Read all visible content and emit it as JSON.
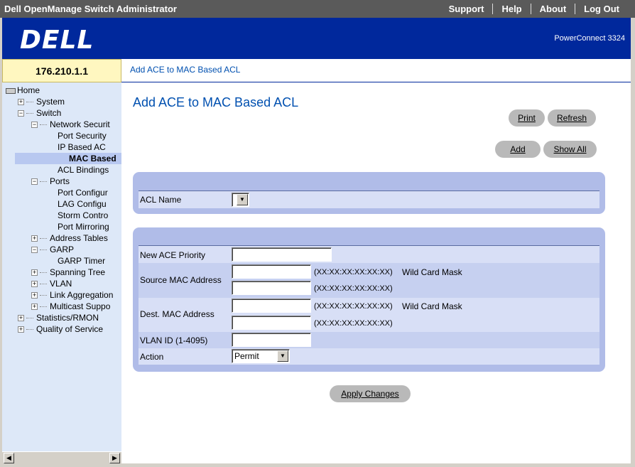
{
  "top_bar": {
    "title": "Dell OpenManage Switch Administrator",
    "links": [
      "Support",
      "Help",
      "About",
      "Log Out"
    ]
  },
  "banner": {
    "logo": "D€LL",
    "model": "PowerConnect 3324"
  },
  "device_ip": "176.210.1.1",
  "breadcrumb": "Add ACE to MAC Based ACL",
  "tree": {
    "home": "Home",
    "system": "System",
    "switch": "Switch",
    "network_security": "Network Securit",
    "port_security": "Port Security",
    "ip_based_acl": "IP Based AC",
    "mac_based_acl": "MAC Based",
    "acl_bindings": "ACL Bindings",
    "ports": "Ports",
    "port_config": "Port Configur",
    "lag_config": "LAG Configu",
    "storm_control": "Storm Contro",
    "port_mirroring": "Port Mirroring",
    "address_tables": "Address Tables",
    "garp": "GARP",
    "garp_timers": "GARP Timer",
    "spanning_tree": "Spanning Tree",
    "vlan": "VLAN",
    "link_aggregation": "Link Aggregation",
    "multicast_support": "Multicast Suppo",
    "statistics_rmon": "Statistics/RMON",
    "quality_of_service": "Quality of Service"
  },
  "page": {
    "title": "Add ACE to MAC Based ACL",
    "buttons": {
      "print": "Print",
      "refresh": "Refresh",
      "add": "Add",
      "show_all": "Show All",
      "apply": "Apply Changes"
    }
  },
  "form": {
    "acl_name_label": "ACL Name",
    "acl_name_value": "",
    "new_ace_priority_label": "New ACE Priority",
    "new_ace_priority_value": "",
    "source_mac_label": "Source MAC Address",
    "source_mac_value": "",
    "source_mac_mask_value": "",
    "dest_mac_label": "Dest. MAC Address",
    "dest_mac_value": "",
    "dest_mac_mask_value": "",
    "mac_format_hint": "(XX:XX:XX:XX:XX:XX)",
    "wild_card_mask_label": "Wild Card Mask",
    "vlan_id_label": "VLAN ID (1-4095)",
    "vlan_id_value": "",
    "action_label": "Action",
    "action_value": "Permit"
  },
  "colors": {
    "banner_blue": "#00289c",
    "title_blue": "#0050b0",
    "panel": "#b0bce8",
    "row": "#d8dff6"
  }
}
